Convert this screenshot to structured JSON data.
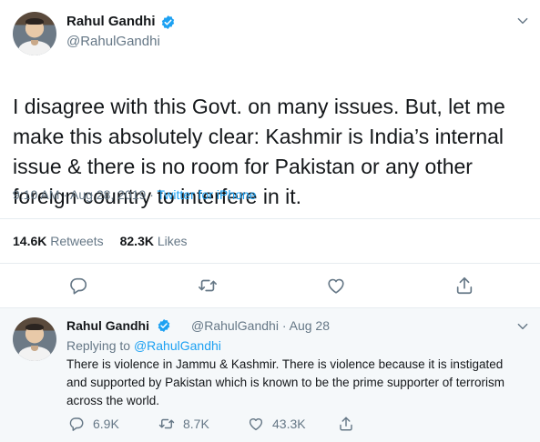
{
  "tweet": {
    "author_name": "Rahul Gandhi",
    "author_handle": "@RahulGandhi",
    "text": "I disagree with this Govt. on many issues. But, let me make this absolutely clear: Kashmir is India’s internal issue & there is no room for Pakistan or any other foreign country to interfere in it.",
    "time": "9:10 AM · Aug 28, 2019 · ",
    "source": "Twitter for iPhone",
    "retweets_count": "14.6K",
    "retweets_label": "Retweets",
    "likes_count": "82.3K",
    "likes_label": "Likes"
  },
  "reply": {
    "author_name": "Rahul Gandhi",
    "meta": "@RahulGandhi · Aug 28",
    "replying_prefix": "Replying to ",
    "replying_handle": "@RahulGandhi",
    "text": "There is violence in Jammu & Kashmir. There is violence because it is instigated and supported by Pakistan which is known to be the prime supporter of terrorism across the world.",
    "reply_count": "6.9K",
    "retweet_count": "8.7K",
    "like_count": "43.3K"
  },
  "icons": [
    "verified-badge-icon",
    "chevron-down-icon",
    "reply-icon",
    "retweet-icon",
    "like-icon",
    "share-icon"
  ],
  "colors": {
    "accent": "#1da1f2",
    "secondary_text": "#657786",
    "primary_text": "#14171a",
    "divider": "#e6ecf0",
    "reply_bg": "#f5f8fa"
  }
}
